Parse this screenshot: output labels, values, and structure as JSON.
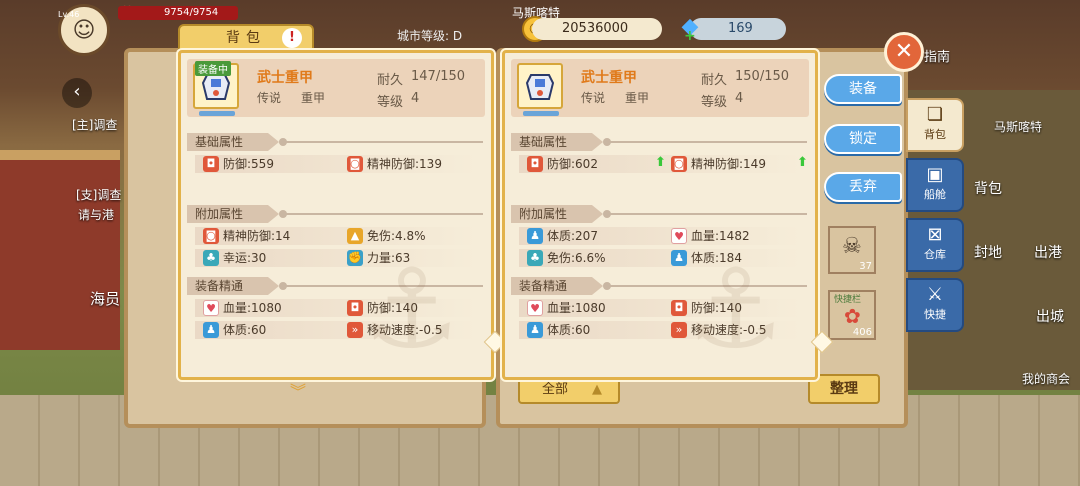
{
  "hud": {
    "level": "Lv.46",
    "hp": "9754/9754",
    "city_level_label": "城市等级",
    "city_level_value": "D",
    "city_name": "马斯喀特",
    "coins": "20536000",
    "gems": "169",
    "guide_label": "指南"
  },
  "bag": {
    "tab_label": "背包",
    "all_button": "全部",
    "sort_button": "整理"
  },
  "side_tabs": [
    {
      "label": "背包",
      "icon": "bag-icon"
    },
    {
      "label": "船舱",
      "icon": "cabin-icon"
    },
    {
      "label": "仓库",
      "icon": "warehouse-icon"
    },
    {
      "label": "快捷",
      "icon": "sword-icon"
    }
  ],
  "actions": {
    "equip": "装备",
    "lock": "锁定",
    "discard": "丢弃"
  },
  "background_labels": {
    "city_right": "马斯喀特",
    "backpack": "背包",
    "fief": "封地",
    "harbor": "出港",
    "exit_city": "出城",
    "my_guild": "我的商会",
    "quest_main": "[主]调查",
    "quest_side": "[支]调查",
    "quest_hint": "请与港",
    "sailor": "海员",
    "quick_bar_1": "快捷栏",
    "quick_bar_2": "快捷栏",
    "count_37": "37",
    "count_406": "406"
  },
  "left_card": {
    "equipped_tag": "装备中",
    "name": "武士重甲",
    "grade": "传说",
    "type": "重甲",
    "durability_label": "耐久",
    "durability": "147/150",
    "level_label": "等级",
    "level": "4",
    "base_title": "基础属性",
    "base_stats": [
      "防御:559",
      "精神防御:139"
    ],
    "extra_title": "附加属性",
    "extra_stats": [
      "精神防御:14",
      "免伤:4.8%",
      "幸运:30",
      "力量:63"
    ],
    "refine_title": "装备精通",
    "refine_stats": [
      "血量:1080",
      "防御:140",
      "体质:60",
      "移动速度:-0.5"
    ]
  },
  "right_card": {
    "name": "武士重甲",
    "grade": "传说",
    "type": "重甲",
    "durability_label": "耐久",
    "durability": "150/150",
    "level_label": "等级",
    "level": "4",
    "base_title": "基础属性",
    "base_stats": [
      "防御:602",
      "精神防御:149"
    ],
    "extra_title": "附加属性",
    "extra_stats": [
      "体质:207",
      "血量:1482",
      "免伤:6.6%",
      "体质:184"
    ],
    "refine_title": "装备精通",
    "refine_stats": [
      "血量:1080",
      "防御:140",
      "体质:60",
      "移动速度:-0.5"
    ]
  },
  "colors": {
    "card_border": "#e2b24a",
    "name_orange": "#e07a1a",
    "action_blue": "#5aa8e8",
    "side_tab_blue": "#3a6aa8",
    "up_green": "#3ac83a"
  }
}
